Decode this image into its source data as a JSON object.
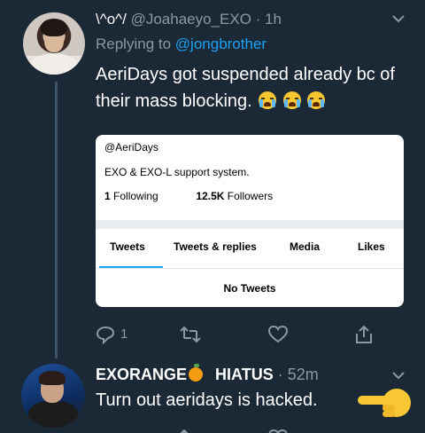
{
  "tweet1": {
    "display_name": "\\^o^/",
    "handle": "@Joahaeyo_EXO",
    "time": "· 1h",
    "replying_prefix": "Replying to",
    "replying_to": "@jongbrother",
    "text": "AeriDays got suspended already bc of their mass blocking.",
    "emoji": "loudly-crying-face x3",
    "card": {
      "handle": "@AeriDays",
      "bio": "EXO & EXO-L support system.",
      "following_count": "1",
      "following_label": "Following",
      "followers_count": "12.5K",
      "followers_label": "Followers",
      "tabs": [
        "Tweets",
        "Tweets & replies",
        "Media",
        "Likes"
      ],
      "active_tab": "Tweets",
      "empty_state": "No Tweets"
    },
    "actions": {
      "reply_count": "1",
      "reply_icon": "reply-icon",
      "retweet_icon": "retweet-icon",
      "like_icon": "heart-icon",
      "share_icon": "share-icon"
    }
  },
  "tweet2": {
    "display_name_a": "EXORANGE",
    "display_name_b": "HIATUS",
    "time": "· 52m",
    "text": "Turn out aeridays is hacked.",
    "emoji": "backhand-index-pointing-right"
  },
  "colors": {
    "background": "#1b2836",
    "muted": "#8899a6",
    "accent": "#1da1f2"
  }
}
